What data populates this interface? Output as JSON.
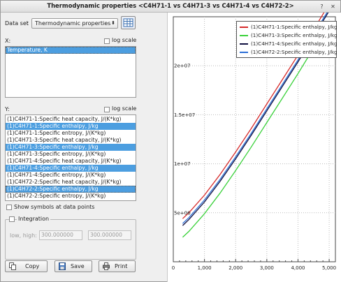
{
  "window": {
    "title": "Thermodynamic properties <C4H71-1 vs C4H71-3 vs C4H71-4 vs C4H72-2>",
    "help": "?",
    "close": "✕"
  },
  "dataset": {
    "label": "Data set",
    "selected": "Thermodynamic properties"
  },
  "x_axis": {
    "label": "X:",
    "log_scale_label": "log scale",
    "items": [
      "Temperature, K"
    ]
  },
  "y_axis": {
    "label": "Y:",
    "log_scale_label": "log scale",
    "items": [
      {
        "text": "(1)C4H71-1:Specific heat capacity, J/(K*kg)",
        "selected": false
      },
      {
        "text": "(1)C4H71-1:Specific enthalpy, J/kg",
        "selected": true
      },
      {
        "text": "(1)C4H71-1:Specific entropy, J/(K*kg)",
        "selected": false
      },
      {
        "text": "(1)C4H71-3:Specific heat capacity, J/(K*kg)",
        "selected": false
      },
      {
        "text": "(1)C4H71-3:Specific enthalpy, J/kg",
        "selected": true
      },
      {
        "text": "(1)C4H71-3:Specific entropy, J/(K*kg)",
        "selected": false
      },
      {
        "text": "(1)C4H71-4:Specific heat capacity, J/(K*kg)",
        "selected": false
      },
      {
        "text": "(1)C4H71-4:Specific enthalpy, J/kg",
        "selected": true
      },
      {
        "text": "(1)C4H71-4:Specific entropy, J/(K*kg)",
        "selected": false
      },
      {
        "text": "(1)C4H72-2:Specific heat capacity, J/(K*kg)",
        "selected": false
      },
      {
        "text": "(1)C4H72-2:Specific enthalpy, J/kg",
        "selected": true
      },
      {
        "text": "(1)C4H72-2:Specific entropy, J/(K*kg)",
        "selected": false
      }
    ]
  },
  "show_symbols_label": "Show symbols at data points",
  "integration": {
    "label": "Integration",
    "low_high_label": "low, high:",
    "low_value": "300.000000",
    "high_value": "300.000000"
  },
  "buttons": {
    "copy": "Copy",
    "save": "Save",
    "print": "Print"
  },
  "colors": {
    "selection": "#4c9ee0",
    "c4h71_1": "#d62a2a",
    "c4h71_3": "#3ad13a",
    "c4h71_4": "#101040",
    "c4h72_2": "#2a6ed6"
  },
  "chart_data": {
    "type": "line",
    "title": "",
    "xlabel": "",
    "ylabel": "",
    "xlim": [
      0,
      5200
    ],
    "ylim": [
      0,
      25000000.0
    ],
    "x_ticks": [
      "0",
      "1,000",
      "2,000",
      "3,000",
      "4,000",
      "5,000"
    ],
    "y_ticks": [
      "5e+06",
      "1e+07",
      "1.5e+07",
      "2e+07"
    ],
    "grid": true,
    "legend_position": "top-right",
    "x": [
      300,
      500,
      1000,
      1500,
      2000,
      2500,
      3000,
      3500,
      4000,
      4500,
      5000
    ],
    "series": [
      {
        "name": "(1)C4H71-1:Specific enthalpy, J/kg",
        "color": "#d62a2a",
        "values": [
          4400000,
          5000000,
          6800000,
          8900000,
          11200000,
          13600000,
          16100000,
          18600000,
          21100000,
          23700000,
          26300000
        ]
      },
      {
        "name": "(1)C4H71-3:Specific enthalpy, J/kg",
        "color": "#3ad13a",
        "values": [
          2500000,
          3100000,
          4900000,
          7000000,
          9300000,
          11700000,
          14200000,
          16700000,
          19200000,
          21800000,
          24400000
        ]
      },
      {
        "name": "(1)C4H71-4:Specific enthalpy, J/kg",
        "color": "#101040",
        "values": [
          3700000,
          4300000,
          6100000,
          8200000,
          10500000,
          12900000,
          15400000,
          17900000,
          20400000,
          23000000,
          25600000
        ]
      },
      {
        "name": "(1)C4H72-2:Specific enthalpy, J/kg",
        "color": "#2a6ed6",
        "values": [
          3900000,
          4500000,
          6300000,
          8400000,
          10700000,
          13100000,
          15600000,
          18100000,
          20600000,
          23200000,
          25800000
        ]
      }
    ]
  }
}
